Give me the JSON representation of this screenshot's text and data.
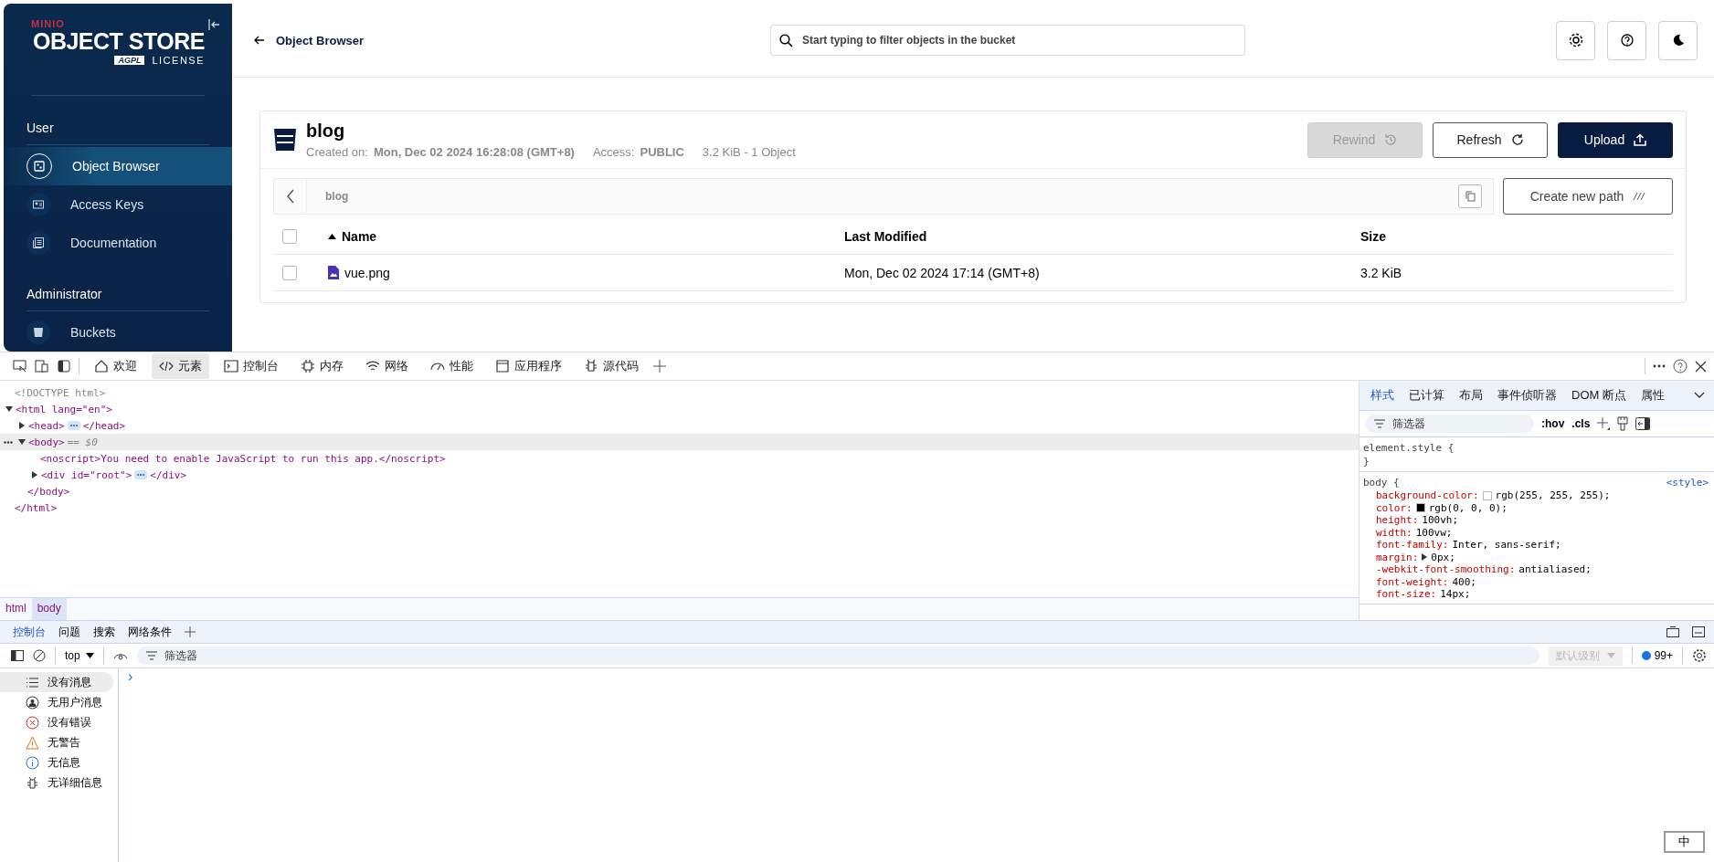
{
  "app": {
    "sidebar": {
      "brand": "MINIO",
      "product": "OBJECT STORE",
      "badge": "AGPL",
      "license": "LICENSE",
      "sections": [
        {
          "title": "User",
          "items": [
            {
              "label": "Object Browser",
              "kind": "browser",
              "selected": true
            },
            {
              "label": "Access Keys",
              "kind": "keys",
              "selected": false
            },
            {
              "label": "Documentation",
              "kind": "docs",
              "selected": false
            }
          ]
        },
        {
          "title": "Administrator",
          "items": [
            {
              "label": "Buckets",
              "kind": "bucket",
              "selected": false
            }
          ]
        }
      ]
    },
    "header": {
      "back": "Object Browser",
      "search": {
        "placeholder": "Start typing to filter objects in the bucket"
      }
    },
    "bucket": {
      "name": "blog",
      "created_label": "Created on:",
      "created": "Mon, Dec 02 2024 16:28:08 (GMT+8)",
      "access_label": "Access:",
      "access": "PUBLIC",
      "summary": "3.2 KiB - 1 Object",
      "buttons": [
        {
          "label": "Rewind",
          "kind": "rewind",
          "disabled": true
        },
        {
          "label": "Refresh",
          "kind": "refresh",
          "disabled": false
        },
        {
          "label": "Upload",
          "kind": "upload",
          "disabled": false
        }
      ],
      "path": "blog",
      "new_path": "Create new path",
      "table": {
        "all_checked": false,
        "columns": [
          {
            "label": "Name",
            "sorted": true
          },
          {
            "label": "Last Modified",
            "sorted": false
          },
          {
            "label": "Size",
            "sorted": false
          }
        ],
        "rows": [
          {
            "name": "vue.png",
            "modified": "Mon, Dec 02 2024 17:14 (GMT+8)",
            "size": "3.2 KiB",
            "checked": false
          }
        ]
      }
    }
  },
  "devtools": {
    "tabs": [
      {
        "label": "欢迎",
        "kind": "welcome",
        "selected": false
      },
      {
        "label": "元素",
        "kind": "elements",
        "selected": true
      },
      {
        "label": "控制台",
        "kind": "console",
        "selected": false
      },
      {
        "label": "内存",
        "kind": "memory",
        "selected": false
      },
      {
        "label": "网络",
        "kind": "network",
        "selected": false
      },
      {
        "label": "性能",
        "kind": "performance",
        "selected": false
      },
      {
        "label": "应用程序",
        "kind": "application",
        "selected": false
      },
      {
        "label": "源代码",
        "kind": "sources",
        "selected": false
      }
    ],
    "elements": {
      "nodes": [
        {
          "text": "<!DOCTYPE html>",
          "kind": "doctype"
        },
        {
          "text": "<html lang=\"en\">",
          "kind": "tag",
          "expanded": true,
          "close": "</html>",
          "children": [
            {
              "text": "<head>",
              "kind": "tag",
              "expanded": false,
              "close": "</head>",
              "selected": false
            },
            {
              "text": "<body>",
              "kind": "tag",
              "expanded": true,
              "close": "</body>",
              "note": "== $0",
              "selected": true,
              "children": [
                {
                  "text": "<noscript>You need to enable JavaScript to run this app.</noscript>",
                  "kind": "tag"
                },
                {
                  "text": "<div id=\"root\">",
                  "kind": "tag",
                  "expanded": false,
                  "close": "</div>",
                  "selected": false
                }
              ]
            }
          ]
        }
      ],
      "breadcrumbs": [
        {
          "label": "html",
          "selected": false
        },
        {
          "label": "body",
          "selected": true
        }
      ]
    },
    "styles": {
      "tabs": [
        {
          "label": "样式",
          "selected": true
        },
        {
          "label": "已计算",
          "selected": false
        },
        {
          "label": "布局",
          "selected": false
        },
        {
          "label": "事件侦听器",
          "selected": false
        },
        {
          "label": "DOM 断点",
          "selected": false
        },
        {
          "label": "属性",
          "selected": false
        }
      ],
      "filter": {
        "placeholder": "筛选器"
      },
      "hov": ":hov",
      "cls": ".cls",
      "rules": [
        {
          "selector": "element.style {",
          "close": "}"
        },
        {
          "selector": "body {",
          "source": "<style>",
          "declarations": [
            {
              "prop": "background-color:",
              "value": "rgb(255, 255, 255);",
              "swatch": true
            },
            {
              "prop": "color:",
              "value": "rgb(0, 0, 0);",
              "swatch": true
            },
            {
              "prop": "height:",
              "value": "100vh;"
            },
            {
              "prop": "width:",
              "value": "100vw;"
            },
            {
              "prop": "font-family:",
              "value": "Inter, sans-serif;"
            },
            {
              "prop": "margin:",
              "value": "0px;",
              "expandable": true
            },
            {
              "prop": "-webkit-font-smoothing:",
              "value": "antialiased;"
            },
            {
              "prop": "font-weight:",
              "value": "400;"
            },
            {
              "prop": "font-size:",
              "value": "14px;"
            }
          ]
        }
      ]
    },
    "console": {
      "tabs": [
        {
          "label": "控制台",
          "selected": true
        },
        {
          "label": "问题",
          "selected": false
        },
        {
          "label": "搜索",
          "selected": false
        },
        {
          "label": "网络条件",
          "selected": false
        }
      ],
      "context": "top",
      "filter": {
        "placeholder": "筛选器"
      },
      "level": "默认级别",
      "level_disabled": true,
      "count": "99+",
      "groups": [
        {
          "label": "没有消息",
          "kind": "messages",
          "selected": true
        },
        {
          "label": "无用户消息",
          "kind": "user",
          "selected": false
        },
        {
          "label": "没有错误",
          "kind": "error",
          "selected": false
        },
        {
          "label": "无警告",
          "kind": "warning",
          "selected": false
        },
        {
          "label": "无信息",
          "kind": "info",
          "selected": false
        },
        {
          "label": "无详细信息",
          "kind": "verbose",
          "selected": false
        }
      ],
      "prompt": "›"
    },
    "ime": "中"
  }
}
